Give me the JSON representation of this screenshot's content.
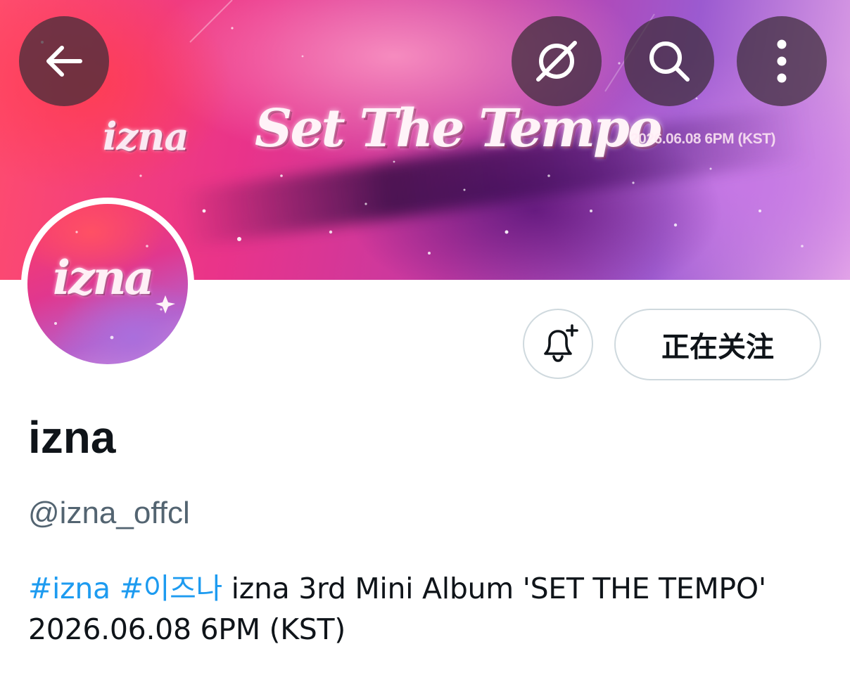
{
  "banner": {
    "logo_text": "izna",
    "title_text": "Set The Tempo",
    "date_text": "2026.06.08 6PM (KST)"
  },
  "header_buttons": {
    "back_icon": "arrow-left-icon",
    "grok_icon": "slash-circle-icon",
    "search_icon": "search-icon",
    "more_icon": "more-vertical-icon",
    "button_bg": "#3c2d37"
  },
  "avatar": {
    "text": "izna"
  },
  "actions": {
    "notify_icon": "bell-plus-icon",
    "follow_label": "正在关注"
  },
  "profile": {
    "display_name": "izna",
    "handle": "@izna_offcl",
    "bio_hashtags": [
      "#izna",
      "#이즈나"
    ],
    "bio_text": " izna 3rd Mini Album 'SET THE TEMPO'  2026.06.08 6PM (KST)"
  },
  "colors": {
    "link": "#1d9bf0",
    "secondary_text": "#536471",
    "primary_text": "#0f1419",
    "border": "#cfd9de"
  }
}
